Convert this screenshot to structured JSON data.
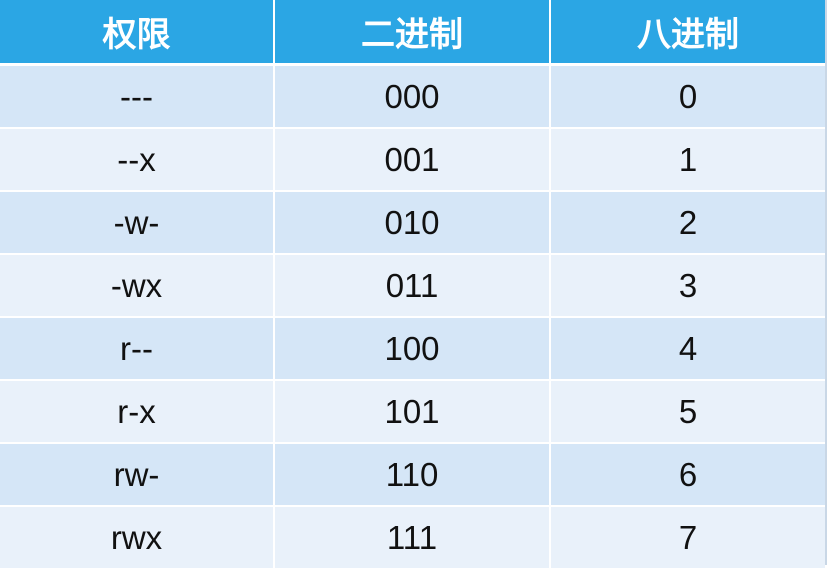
{
  "table": {
    "headers": [
      "权限",
      "二进制",
      "八进制"
    ],
    "rows": [
      [
        "---",
        "000",
        "0"
      ],
      [
        "--x",
        "001",
        "1"
      ],
      [
        "-w-",
        "010",
        "2"
      ],
      [
        "-wx",
        "011",
        "3"
      ],
      [
        "r--",
        "100",
        "4"
      ],
      [
        "r-x",
        "101",
        "5"
      ],
      [
        "rw-",
        "110",
        "6"
      ],
      [
        "rwx",
        "111",
        "7"
      ]
    ]
  },
  "colors": {
    "header_bg": "#2ba6e4",
    "header_text": "#ffffff",
    "row_odd_bg": "#d5e6f7",
    "row_even_bg": "#e9f1fa",
    "cell_text": "#111111"
  }
}
